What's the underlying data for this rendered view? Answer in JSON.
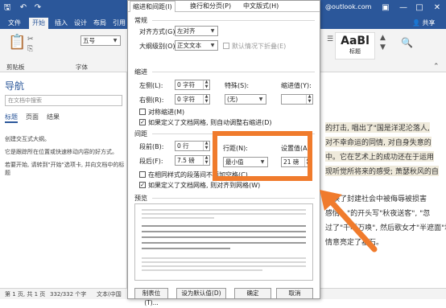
{
  "word": {
    "qat_icons": [
      "save-icon",
      "undo-icon",
      "redo-icon"
    ],
    "account_email": "@outlook.com",
    "share_label": "共享",
    "tabs": [
      "文件",
      "开始",
      "插入",
      "设计",
      "布局",
      "引用"
    ],
    "font_size": "五号",
    "font_group_label": "字体",
    "clipboard_label": "剪贴板",
    "style_preview": "AaBl",
    "style_name": "标题",
    "nav": {
      "title": "导航",
      "search_placeholder": "在文档中搜索",
      "tabs": [
        "标题",
        "页面",
        "结果"
      ],
      "paras": [
        "创建交互式大纲。",
        "它是跟踪所在位置或快速移动内容的好方式。",
        "若要开始, 请转到\"开始\"选项卡, 并向文档中的标题"
      ]
    },
    "doc_lines": [
      "的打击, 唱出了\"国是洋泥沦落人,",
      "对不幸命运的同情, 对自身失意的",
      "中。它在艺术上的成功还在于运用",
      "现听觉所将来的感受; 萧瑟秋风的自",
      "反映了封建社会中被侮辱被损害",
      "感情。\"的开头写\"秋夜送客\", \"忽",
      "过了\"千呼万唤\", 然后歌女才\"半遮面\"地",
      "情意亮定了基石。"
    ],
    "status": {
      "page": "第 1 页, 共 1 页",
      "words": "332/332 个字",
      "lang": "文本(中国"
    }
  },
  "dialog": {
    "tabs": [
      "缩进和间距(I)",
      "换行和分页(P)",
      "中文版式(H)"
    ],
    "sec_general": "常规",
    "alignment_label": "对齐方式(G):",
    "alignment_value": "左对齐",
    "outline_label": "大纲级别(O):",
    "outline_value": "正文文本",
    "collapse_label": "默认情况下折叠(E)",
    "sec_indent": "缩进",
    "left_label": "左侧(L):",
    "left_value": "0 字符",
    "right_label": "右侧(R):",
    "right_value": "0 字符",
    "special_label": "特殊(S):",
    "special_value": "(无)",
    "indent_value_label": "缩进值(Y):",
    "mirror_label": "对称缩进(M)",
    "auto_right_label": "如果定义了文档网格, 则自动调整右缩进(D)",
    "sec_spacing": "间距",
    "before_label": "段前(B):",
    "before_value": "0 行",
    "after_label": "段后(F):",
    "after_value": "7.5 磅",
    "no_space_label": "在相同样式的段落间不添加空格(C)",
    "snap_grid_label": "如果定义了文档网格, 则对齐到网格(W)",
    "line_spacing_label": "行距(N):",
    "line_spacing_value": "最小值",
    "at_label": "设置值(A):",
    "at_value": "21 磅",
    "preview_label": "预览",
    "buttons": {
      "tabs": "制表位(T)...",
      "default": "设为默认值(D)",
      "ok": "确定",
      "cancel": "取消"
    }
  },
  "colors": {
    "word_blue": "#2b579a",
    "highlight": "#f07b2c"
  }
}
